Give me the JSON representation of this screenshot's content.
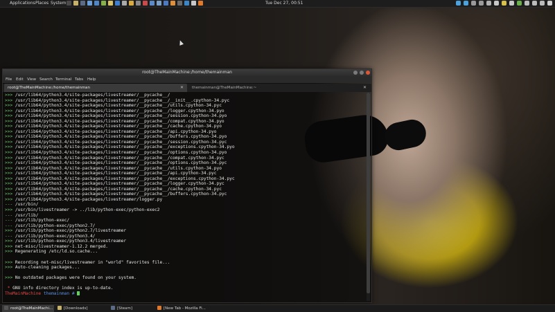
{
  "top_panel": {
    "menus": [
      "Applications",
      "Places",
      "System"
    ],
    "clock": "Tue Dec 27, 00:51",
    "launchers": [
      {
        "icon": "terminal-icon",
        "color": "#4a4a4a"
      },
      {
        "icon": "folder-icon",
        "color": "#c8b26a"
      },
      {
        "icon": "steam-icon",
        "color": "#5b6b86"
      },
      {
        "icon": "app-icon",
        "color": "#6a9ed8"
      },
      {
        "icon": "app-icon",
        "color": "#4f86c6"
      },
      {
        "icon": "app-icon",
        "color": "#86b04a"
      },
      {
        "icon": "mail-icon",
        "color": "#d8c26a"
      },
      {
        "icon": "app-icon",
        "color": "#3c7fd0"
      },
      {
        "icon": "app-icon",
        "color": "#aaaaaa"
      },
      {
        "icon": "app-icon",
        "color": "#d8aa40"
      },
      {
        "icon": "app-icon",
        "color": "#888888"
      },
      {
        "icon": "app-icon",
        "color": "#c84a4a"
      },
      {
        "icon": "app-icon",
        "color": "#5a8ac8"
      },
      {
        "icon": "app-icon",
        "color": "#7aa0c8"
      },
      {
        "icon": "app-icon",
        "color": "#4a7abf"
      },
      {
        "icon": "app-icon",
        "color": "#e0903a"
      },
      {
        "icon": "app-icon",
        "color": "#6a6a6a"
      },
      {
        "icon": "app-icon",
        "color": "#3a86c8"
      },
      {
        "icon": "app-icon",
        "color": "#c8c8c8"
      },
      {
        "icon": "firefox-icon",
        "color": "#e07a2a"
      }
    ],
    "tray": [
      {
        "icon": "twitter-icon",
        "color": "#4aa3df"
      },
      {
        "icon": "twitter-icon",
        "color": "#4aa3df"
      },
      {
        "icon": "mail-icon",
        "color": "#9a9a9a"
      },
      {
        "icon": "display-icon",
        "color": "#9a9a9a"
      },
      {
        "icon": "box-icon",
        "color": "#b0b0b0"
      },
      {
        "icon": "grid-icon",
        "color": "#c8c8c8"
      },
      {
        "icon": "badge-icon",
        "color": "#d6c24a"
      },
      {
        "icon": "app-icon",
        "color": "#c8c8c8"
      },
      {
        "icon": "app-icon",
        "color": "#6ab04a"
      },
      {
        "icon": "network-icon",
        "color": "#bbbbbb"
      },
      {
        "icon": "volume-icon",
        "color": "#bbbbbb"
      },
      {
        "icon": "app-icon",
        "color": "#bbbbbb"
      },
      {
        "icon": "power-icon",
        "color": "#cfcfcf"
      }
    ]
  },
  "window": {
    "title": "root@TheMainMachine:/home/themainman",
    "menu": [
      "File",
      "Edit",
      "View",
      "Search",
      "Terminal",
      "Tabs",
      "Help"
    ],
    "tabs": [
      {
        "label": "root@TheMainMachine:/home/themainman",
        "active": true
      },
      {
        "label": "themainman@TheMainMachine:~",
        "active": false
      }
    ],
    "lines": [
      ">>> /usr/lib64/python3.4/site-packages/livestreamer/__pycache__/",
      ">>> /usr/lib64/python3.4/site-packages/livestreamer/__pycache__/__init__.cpython-34.pyc",
      ">>> /usr/lib64/python3.4/site-packages/livestreamer/__pycache__/utils.cpython-34.pyc",
      ">>> /usr/lib64/python3.4/site-packages/livestreamer/__pycache__/logger.cpython-34.pyo",
      ">>> /usr/lib64/python3.4/site-packages/livestreamer/__pycache__/session.cpython-34.pyo",
      ">>> /usr/lib64/python3.4/site-packages/livestreamer/__pycache__/compat.cpython-34.pyo",
      ">>> /usr/lib64/python3.4/site-packages/livestreamer/__pycache__/cache.cpython-34.pyo",
      ">>> /usr/lib64/python3.4/site-packages/livestreamer/__pycache__/api.cpython-34.pyo",
      ">>> /usr/lib64/python3.4/site-packages/livestreamer/__pycache__/buffers.cpython-34.pyo",
      ">>> /usr/lib64/python3.4/site-packages/livestreamer/__pycache__/session.cpython-34.pyc",
      ">>> /usr/lib64/python3.4/site-packages/livestreamer/__pycache__/exceptions.cpython-34.pyo",
      ">>> /usr/lib64/python3.4/site-packages/livestreamer/__pycache__/options.cpython-34.pyo",
      ">>> /usr/lib64/python3.4/site-packages/livestreamer/__pycache__/compat.cpython-34.pyc",
      ">>> /usr/lib64/python3.4/site-packages/livestreamer/__pycache__/options.cpython-34.pyc",
      ">>> /usr/lib64/python3.4/site-packages/livestreamer/__pycache__/utils.cpython-34.pyo",
      ">>> /usr/lib64/python3.4/site-packages/livestreamer/__pycache__/api.cpython-34.pyc",
      ">>> /usr/lib64/python3.4/site-packages/livestreamer/__pycache__/exceptions.cpython-34.pyc",
      ">>> /usr/lib64/python3.4/site-packages/livestreamer/__pycache__/logger.cpython-34.pyc",
      ">>> /usr/lib64/python3.4/site-packages/livestreamer/__pycache__/cache.cpython-34.pyc",
      ">>> /usr/lib64/python3.4/site-packages/livestreamer/__pycache__/buffers.cpython-34.pyc",
      ">>> /usr/lib64/python3.4/site-packages/livestreamer/logger.py",
      "--- /usr/bin/",
      ">>> /usr/bin/livestreamer -> ../lib/python-exec/python-exec2",
      "--- /usr/lib/",
      "--- /usr/lib/python-exec/",
      "--- /usr/lib/python-exec/python2.7/",
      ">>> /usr/lib/python-exec/python2.7/livestreamer",
      "--- /usr/lib/python-exec/python3.4/",
      ">>> /usr/lib/python-exec/python3.4/livestreamer",
      ">>> net-misc/livestreamer-1.12.2 merged.",
      ">>> Regenerating /etc/ld.so.cache...",
      "",
      ">>> Recording net-misc/livestreamer in \"world\" favorites file...",
      ">>> Auto-cleaning packages...",
      "",
      ">>> No outdated packages were found on your system.",
      "",
      " * GNU info directory index is up-to-date."
    ],
    "prompt": {
      "host": "TheMainMachine",
      "path": "themainman #"
    }
  },
  "taskbar": [
    {
      "label": "root@TheMainMachi...",
      "icon": "terminal-icon",
      "color": "#555555",
      "active": true
    },
    {
      "label": "[Downloads]",
      "icon": "folder-icon",
      "color": "#c8b26a",
      "active": false
    },
    {
      "label": "[Steam]",
      "icon": "steam-icon",
      "color": "#5b6b86",
      "active": false
    },
    {
      "label": "[New Tab - Mozilla Fi...",
      "icon": "firefox-icon",
      "color": "#e07a2a",
      "active": false
    }
  ]
}
